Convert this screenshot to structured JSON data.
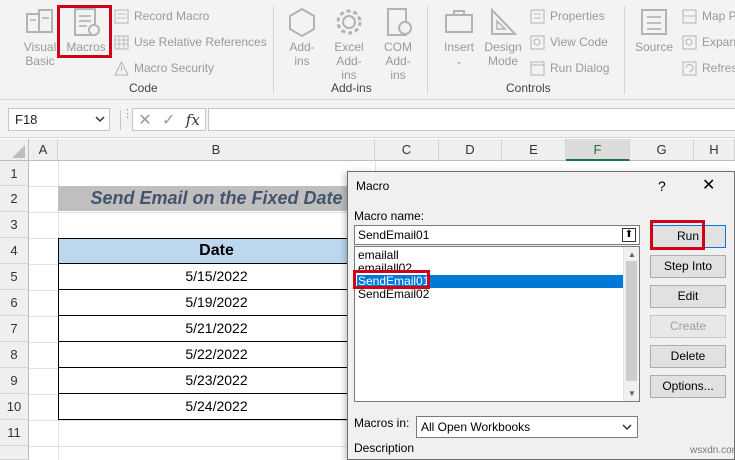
{
  "ribbon": {
    "code_group": {
      "label": "Code",
      "visual_basic": "Visual Basic",
      "macros": "Macros",
      "record_macro": "Record Macro",
      "relative_refs": "Use Relative References",
      "macro_security": "Macro Security"
    },
    "addins_group": {
      "label": "Add-ins",
      "addins": "Add-ins",
      "excel_addins": "Excel Add-ins",
      "com_addins": "COM Add-ins"
    },
    "controls_group": {
      "label": "Controls",
      "insert": "Insert",
      "design_mode": "Design Mode",
      "properties": "Properties",
      "view_code": "View Code",
      "run_dialog": "Run Dialog"
    },
    "xml_group": {
      "source": "Source",
      "map_props": "Map Pr",
      "expansion": "Expan",
      "refresh": "Refresh"
    }
  },
  "formula_bar": {
    "name_box": "F18",
    "cancel": "✕",
    "enter": "✓",
    "fx": "fx",
    "value": ""
  },
  "columns": [
    "A",
    "B",
    "C",
    "D",
    "E",
    "F",
    "G",
    "H"
  ],
  "rows": [
    "1",
    "2",
    "3",
    "4",
    "5",
    "6",
    "7",
    "8",
    "9",
    "10",
    "11"
  ],
  "sheet": {
    "title": "Send Email on the Fixed Date",
    "date_header": "Date",
    "dates": [
      "5/15/2022",
      "5/19/2022",
      "5/21/2022",
      "5/22/2022",
      "5/23/2022",
      "5/24/2022"
    ]
  },
  "dialog": {
    "title": "Macro",
    "help": "?",
    "close": "✕",
    "macro_name_label": "Macro name:",
    "macro_name_value": "SendEmail01",
    "macros": [
      "emailall",
      "emailall02",
      "SendEmail01",
      "SendEmail02"
    ],
    "selected_index": 2,
    "macros_in_label": "Macros in:",
    "macros_in_value": "All Open Workbooks",
    "description_label": "Description",
    "buttons": {
      "run": "Run",
      "step_into": "Step Into",
      "edit": "Edit",
      "create": "Create",
      "delete": "Delete",
      "options": "Options..."
    }
  },
  "watermark": "wsxdn.com"
}
